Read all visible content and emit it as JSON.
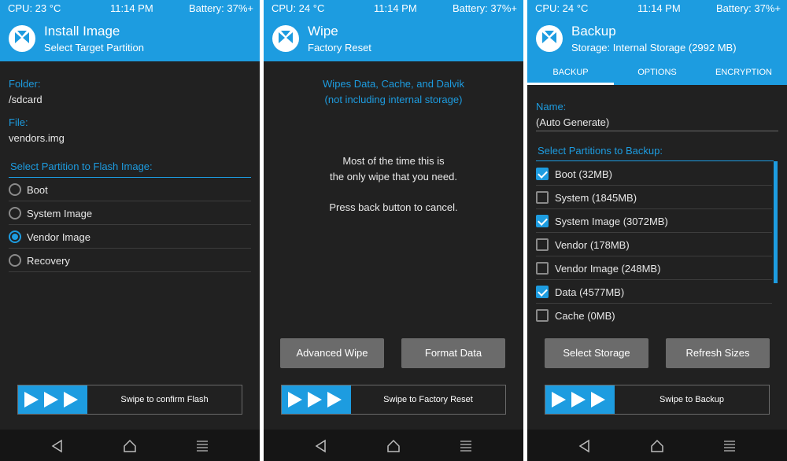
{
  "colors": {
    "accent": "#1d9ce0",
    "background": "#212121",
    "button": "#6b6b6b",
    "navbar": "#151515"
  },
  "panels": [
    {
      "status": {
        "cpu": "CPU: 23 °C",
        "time": "11:14 PM",
        "battery": "Battery: 37%+"
      },
      "title": "Install Image",
      "subtitle": "Select Target Partition",
      "folder_label": "Folder:",
      "folder_value": "/sdcard",
      "file_label": "File:",
      "file_value": "vendors.img",
      "partition_header": "Select Partition to Flash Image:",
      "options": [
        {
          "label": "Boot",
          "selected": false
        },
        {
          "label": "System Image",
          "selected": false
        },
        {
          "label": "Vendor Image",
          "selected": true
        },
        {
          "label": "Recovery",
          "selected": false
        }
      ],
      "swipe_text": "Swipe to confirm Flash"
    },
    {
      "status": {
        "cpu": "CPU: 24 °C",
        "time": "11:14 PM",
        "battery": "Battery: 37%+"
      },
      "title": "Wipe",
      "subtitle": "Factory Reset",
      "info_line1": "Wipes Data, Cache, and Dalvik",
      "info_line2": "(not including internal storage)",
      "msg_line1": "Most of the time this is",
      "msg_line2": "the only wipe that you need.",
      "msg_line3": "Press back button to cancel.",
      "advanced_wipe_button": "Advanced Wipe",
      "format_data_button": "Format Data",
      "swipe_text": "Swipe to Factory Reset"
    },
    {
      "status": {
        "cpu": "CPU: 24 °C",
        "time": "11:14 PM",
        "battery": "Battery: 37%+"
      },
      "title": "Backup",
      "subtitle": "Storage: Internal Storage (2992 MB)",
      "tabs": [
        "BACKUP",
        "OPTIONS",
        "ENCRYPTION"
      ],
      "active_tab": "BACKUP",
      "name_label": "Name:",
      "name_value": "(Auto Generate)",
      "partitions_header": "Select Partitions to Backup:",
      "partitions": [
        {
          "label": "Boot (32MB)",
          "checked": true
        },
        {
          "label": "System (1845MB)",
          "checked": false
        },
        {
          "label": "System Image (3072MB)",
          "checked": true
        },
        {
          "label": "Vendor (178MB)",
          "checked": false
        },
        {
          "label": "Vendor Image (248MB)",
          "checked": false
        },
        {
          "label": "Data (4577MB)",
          "checked": true
        },
        {
          "label": "Cache (0MB)",
          "checked": false
        }
      ],
      "select_storage_button": "Select Storage",
      "refresh_sizes_button": "Refresh Sizes",
      "swipe_text": "Swipe to Backup"
    }
  ],
  "icons": {
    "logo": "twrp-logo-icon",
    "swipe": "triple-arrow-icon",
    "nav_back": "back-triangle-icon",
    "nav_home": "home-icon",
    "nav_menu": "menu-icon"
  }
}
